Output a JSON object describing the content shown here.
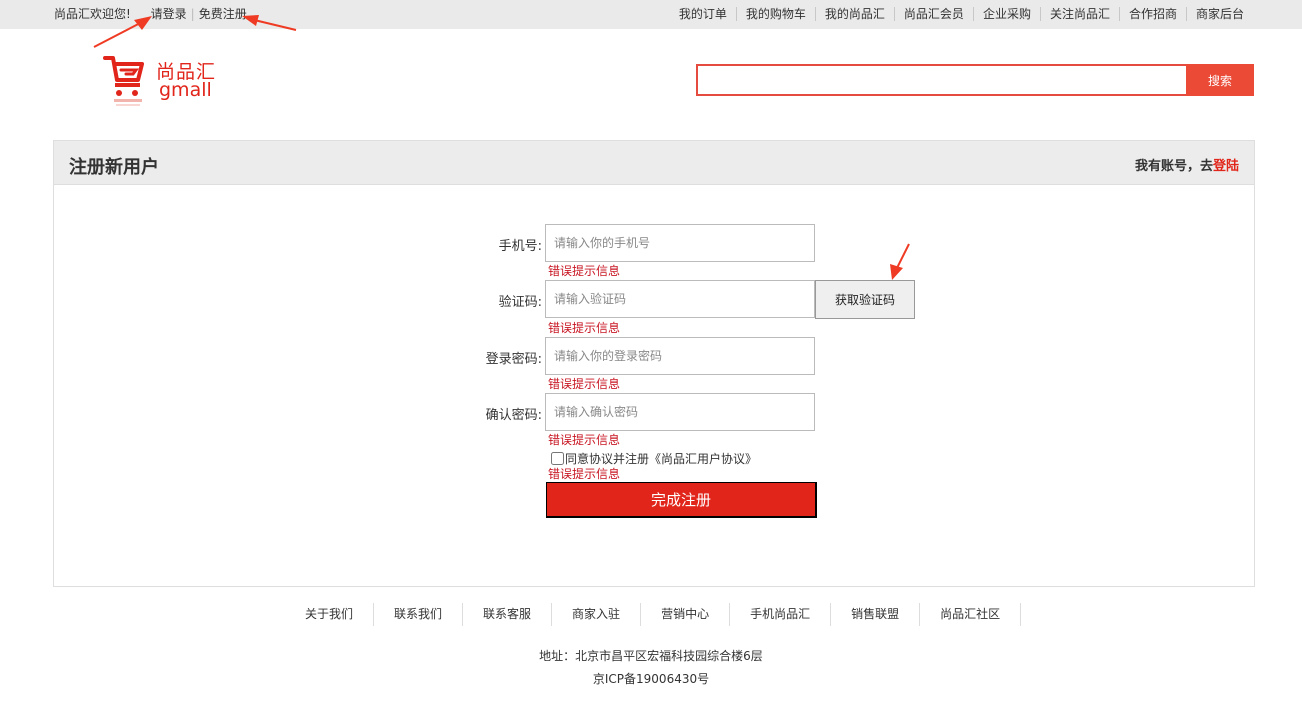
{
  "topbar": {
    "welcome": "尚品汇欢迎您!",
    "login": "请登录",
    "register": "免费注册",
    "nav": [
      "我的订单",
      "我的购物车",
      "我的尚品汇",
      "尚品汇会员",
      "企业采购",
      "关注尚品汇",
      "合作招商",
      "商家后台"
    ]
  },
  "logo": {
    "cn": "尚品汇",
    "en": "gmall",
    "icon": "shopping-cart-icon"
  },
  "search": {
    "button": "搜索",
    "value": ""
  },
  "register": {
    "title": "注册新用户",
    "have_account": "我有账号，去",
    "login_link": "登陆",
    "fields": [
      {
        "label": "手机号:",
        "placeholder": "请输入你的手机号",
        "error": "错误提示信息"
      },
      {
        "label": "验证码:",
        "placeholder": "请输入验证码",
        "error": "错误提示信息"
      },
      {
        "label": "登录密码:",
        "placeholder": "请输入你的登录密码",
        "error": "错误提示信息"
      },
      {
        "label": "确认密码:",
        "placeholder": "请输入确认密码",
        "error": "错误提示信息"
      }
    ],
    "get_code": "获取验证码",
    "agree": "同意协议并注册《尚品汇用户协议》",
    "agree_error": "错误提示信息",
    "submit": "完成注册"
  },
  "footer": {
    "links": [
      "关于我们",
      "联系我们",
      "联系客服",
      "商家入驻",
      "营销中心",
      "手机尚品汇",
      "销售联盟",
      "尚品汇社区"
    ],
    "address": "地址：北京市昌平区宏福科技园综合楼6层",
    "icp": "京ICP备19006430号"
  },
  "colors": {
    "accent": "#e1251b",
    "search_border": "#e54b3e",
    "error": "#c81623"
  }
}
